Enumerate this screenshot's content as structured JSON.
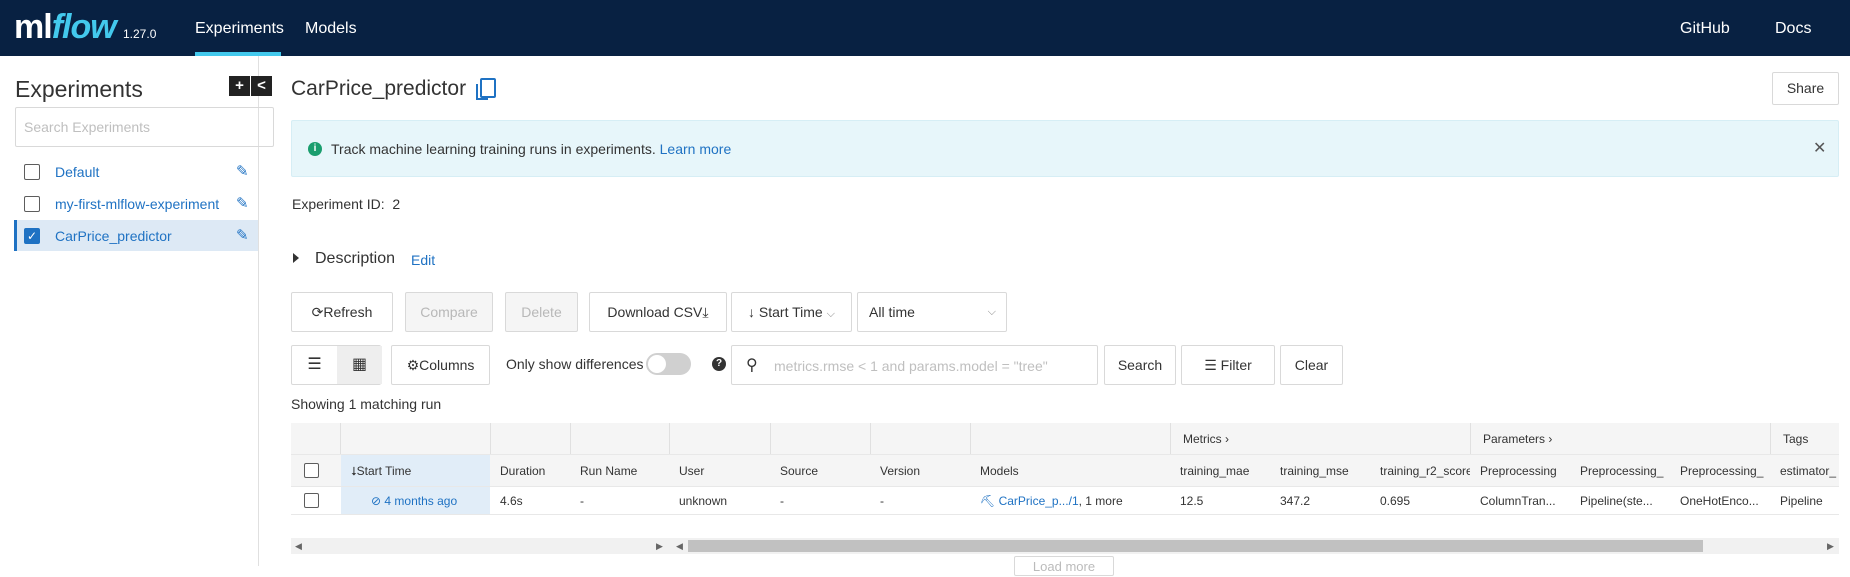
{
  "app": {
    "logo_ml": "ml",
    "logo_flow": "flow",
    "version": "1.27.0",
    "nav": [
      "Experiments",
      "Models"
    ],
    "right_nav": [
      "GitHub",
      "Docs"
    ]
  },
  "sidebar": {
    "title": "Experiments",
    "add_button": "+",
    "collapse_button": "<",
    "search_placeholder": "Search Experiments",
    "experiments": [
      {
        "name": "Default",
        "checked": false
      },
      {
        "name": "my-first-mlflow-experiment",
        "checked": false
      },
      {
        "name": "CarPrice_predictor",
        "checked": true
      }
    ]
  },
  "main": {
    "title": "CarPrice_predictor",
    "share_label": "Share",
    "banner_text": "Track machine learning training runs in experiments.",
    "banner_link": "Learn more",
    "experiment_id_label": "Experiment ID:",
    "experiment_id": "2",
    "description_label": "Description",
    "description_edit": "Edit",
    "toolbar": {
      "refresh": "Refresh",
      "compare": "Compare",
      "delete": "Delete",
      "download_csv": "Download CSV",
      "sort_by": "Start Time",
      "time_range": "All time",
      "columns": "Columns",
      "only_show_diffs": "Only show differences",
      "search_placeholder": "metrics.rmse < 1 and params.model = \"tree\"",
      "search": "Search",
      "filter": "Filter",
      "clear": "Clear"
    },
    "showing": "Showing 1 matching run",
    "table": {
      "groups": {
        "metrics": "Metrics",
        "parameters": "Parameters",
        "tags": "Tags"
      },
      "headers": [
        "Start Time",
        "Duration",
        "Run Name",
        "User",
        "Source",
        "Version",
        "Models",
        "training_mae",
        "training_mse",
        "training_r2_score",
        "Preprocessing",
        "Preprocessing_",
        "Preprocessing_",
        "estimator_"
      ],
      "row": {
        "start_time": "4 months ago",
        "duration": "4.6s",
        "run_name": "-",
        "user": "unknown",
        "source": "-",
        "version": "-",
        "model_link": "CarPrice_p.../1",
        "model_more": ", 1 more",
        "training_mae": "12.5",
        "training_mse": "347.2",
        "training_r2": "0.695",
        "preprocessing": "ColumnTran...",
        "preprocessing_1": "Pipeline(ste...",
        "preprocessing_2": "OneHotEnco...",
        "estimator": "Pipeline"
      }
    },
    "load_more": "Load more"
  }
}
